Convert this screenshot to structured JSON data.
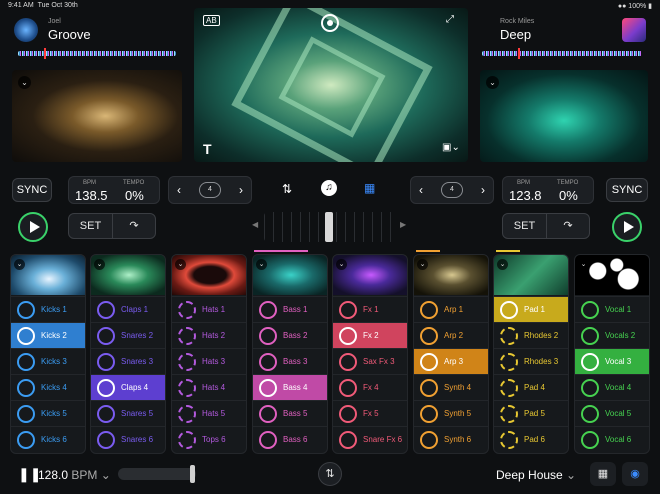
{
  "status": {
    "time": "9:41 AM",
    "date": "Tue Oct 30th",
    "battery": "100%"
  },
  "deck_a": {
    "artist": "Joel",
    "title": "Groove",
    "sync": "SYNC",
    "bpm_label": "BPM",
    "bpm": "138.5",
    "tempo_label": "TEMPO",
    "tempo": "0%",
    "loop": "4",
    "set": "SET"
  },
  "deck_b": {
    "artist": "Rock Miles",
    "title": "Deep",
    "sync": "SYNC",
    "bpm_label": "BPM",
    "bpm": "123.8",
    "tempo_label": "TEMPO",
    "tempo": "0%",
    "loop": "4",
    "set": "SET"
  },
  "main": {
    "text_toggle": "T"
  },
  "columns": [
    {
      "color": "#3b9cf2",
      "active_bg": "#2f7fd0",
      "pads": [
        "Kicks 1",
        "Kicks 2",
        "Kicks 3",
        "Kicks 4",
        "Kicks 5",
        "Kicks 6"
      ],
      "active": 1
    },
    {
      "color": "#7a5cf0",
      "active_bg": "#5d3fd0",
      "pads": [
        "Claps 1",
        "Snares 2",
        "Snares 3",
        "Claps 4",
        "Snares 5",
        "Snares 6"
      ],
      "active": 3
    },
    {
      "color": "#b45adf",
      "active_bg": "#9040c0",
      "pads": [
        "Hats 1",
        "Hats 2",
        "Hats 3",
        "Hats 4",
        "Hats 5",
        "Tops 6"
      ],
      "active": -1
    },
    {
      "color": "#e060c0",
      "active_bg": "#c04aa6",
      "pads": [
        "Bass 1",
        "Bass 2",
        "Bass 3",
        "Bass 4",
        "Bass 5",
        "Bass 6"
      ],
      "active": 3
    },
    {
      "color": "#f05a78",
      "active_bg": "#d0445e",
      "pads": [
        "Fx 1",
        "Fx 2",
        "Sax Fx 3",
        "Fx 4",
        "Fx 5",
        "Snare Fx 6"
      ],
      "active": 1
    },
    {
      "color": "#f0a032",
      "active_bg": "#d08418",
      "pads": [
        "Arp 1",
        "Arp 2",
        "Arp 3",
        "Synth 4",
        "Synth 5",
        "Synth 6"
      ],
      "active": 2
    },
    {
      "color": "#e8c832",
      "active_bg": "#c8aa1c",
      "pads": [
        "Pad 1",
        "Rhodes 2",
        "Rhodes 3",
        "Pad 4",
        "Pad 5",
        "Pad 6"
      ],
      "active": 0
    },
    {
      "color": "#46d250",
      "active_bg": "#34b040",
      "pads": [
        "Vocal 1",
        "Vocals 2",
        "Vocal 3",
        "Vocal 4",
        "Vocal 5",
        "Vocal 6"
      ],
      "active": 2
    }
  ],
  "bottom": {
    "bpm": "128.0",
    "bpm_unit": "BPM",
    "genre": "Deep House"
  }
}
